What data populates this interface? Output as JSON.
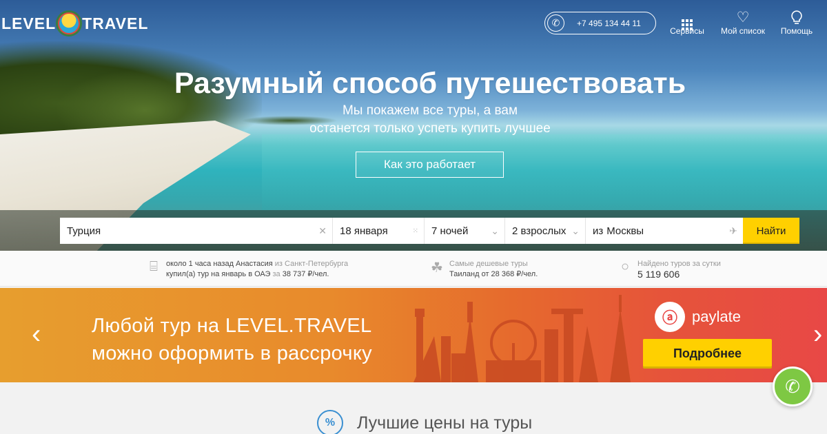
{
  "header": {
    "logo_left": "LEVEL",
    "logo_right": "TRAVEL",
    "phone": "+7 495 134 44 11",
    "nav": [
      {
        "label": "Сервисы",
        "icon": "grid-icon"
      },
      {
        "label": "Мой список",
        "icon": "heart-icon"
      },
      {
        "label": "Помощь",
        "icon": "lightbulb-icon"
      }
    ]
  },
  "hero": {
    "title": "Разумный способ путешествовать",
    "subtitle_line1": "Мы покажем все туры, а вам",
    "subtitle_line2": "останется только успеть купить лучшее",
    "how_button": "Как это работает"
  },
  "search": {
    "destination": "Турция",
    "date": "18 января",
    "nights": "7 ночей",
    "guests": "2 взрослых",
    "from_prefix": "из",
    "from_city": "Москвы",
    "submit": "Найти"
  },
  "info": {
    "recent_line1_a": "около 1 часа назад Анастасия",
    "recent_line1_b": "из Санкт-Петербурга",
    "recent_line2_a": "купил(а) тур на январь в ОАЭ",
    "recent_line2_b": "за",
    "recent_price": "38 737 ₽/чел.",
    "cheap_label": "Самые дешевые туры",
    "cheap_value": "Таиланд от 28 368 ₽/чел.",
    "found_label": "Найдено туров за сутки",
    "found_value": "5 119 606"
  },
  "promo": {
    "line1": "Любой тур на LEVEL.TRAVEL",
    "line2": "можно оформить в рассрочку",
    "brand": "paylate",
    "button": "Подробнее"
  },
  "section": {
    "title": "Лучшие цены на туры",
    "badge": "%"
  },
  "colors": {
    "accent_yellow": "#ffd000",
    "promo_orange": "#e88a2c",
    "promo_red": "#e84846",
    "call_green": "#7ec843",
    "section_blue": "#3a8fd1"
  }
}
